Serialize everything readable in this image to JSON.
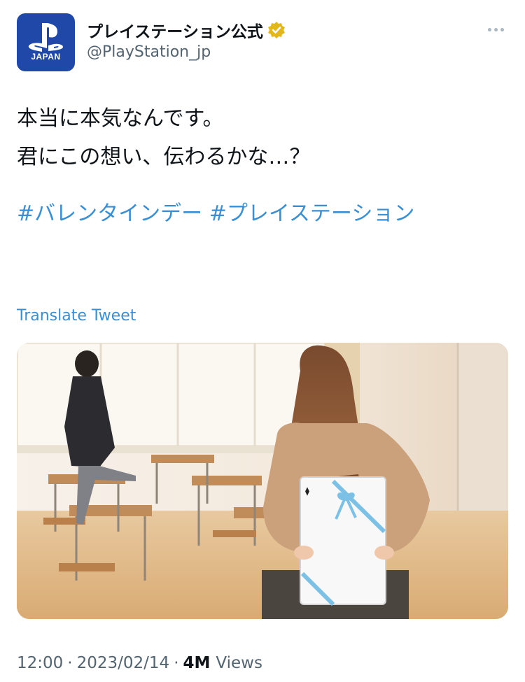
{
  "account": {
    "display_name": "プレイステーション公式",
    "handle": "@PlayStation_jp",
    "avatar_caption": "JAPAN",
    "verified_badge_color": "#e2b719"
  },
  "tweet": {
    "lines": [
      "本当に本気なんです。",
      "君にこの想い、伝わるかな…？"
    ],
    "hashtags": [
      "#バレンタインデー",
      "#プレイステーション"
    ],
    "translate_label": "Translate Tweet",
    "time": "12:00",
    "date": "2023/02/14",
    "views_count": "4M",
    "views_label": "Views",
    "separator": "·"
  },
  "icons": {
    "more": "more-options-icon",
    "verified": "verified-badge-icon",
    "logo": "playstation-logo-icon"
  },
  "colors": {
    "accent_link": "#3a8fd4",
    "avatar_bg": "#1f48a8",
    "ribbon": "#7cc0e6"
  }
}
